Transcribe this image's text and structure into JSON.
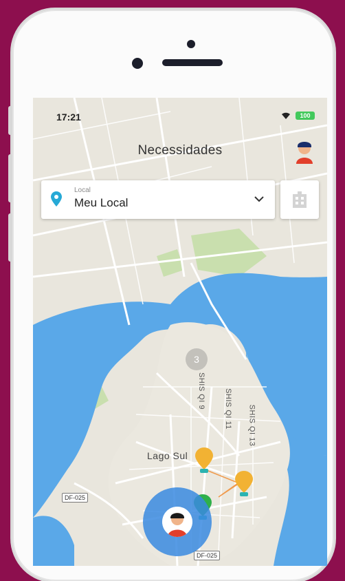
{
  "status_bar": {
    "time": "17:21",
    "battery": "100"
  },
  "header": {
    "title": "Necessidades"
  },
  "location": {
    "caption": "Local",
    "value": "Meu Local"
  },
  "map": {
    "district_label": "Lago Sul",
    "cluster_count": "3",
    "road_tags": [
      "DF-025",
      "DF-025"
    ],
    "street_labels": [
      "SHIS QI 9",
      "SHIS QI 11",
      "SHIS QI 13"
    ],
    "water_color": "#5aa8e8",
    "park_color": "#c9dfae"
  },
  "pins": [
    {
      "color": "#f2b233"
    },
    {
      "color": "#f2b233"
    },
    {
      "color": "#2fb04a"
    }
  ]
}
